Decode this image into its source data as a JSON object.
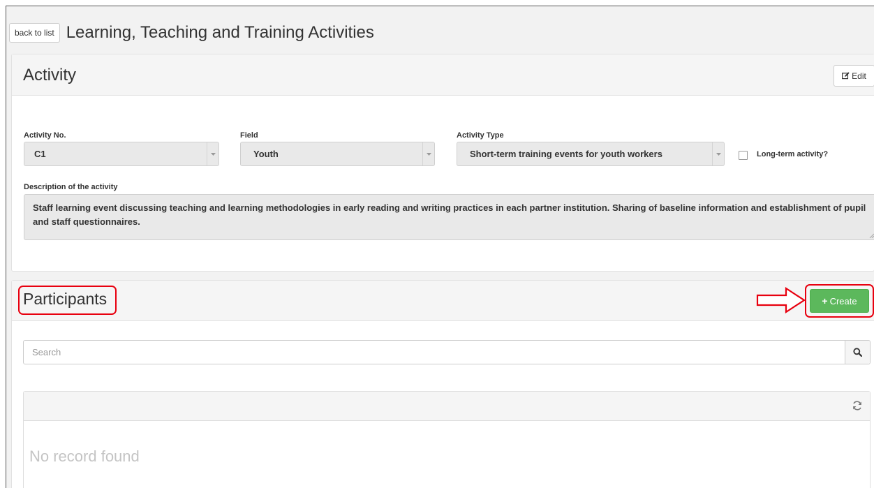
{
  "header": {
    "back_label": "back to list",
    "title": "Learning, Teaching and Training Activities"
  },
  "activity": {
    "title": "Activity",
    "edit_label": "Edit",
    "edit_icon": "edit-icon",
    "fields": {
      "activity_no": {
        "label": "Activity No.",
        "value": "C1"
      },
      "field": {
        "label": "Field",
        "value": "Youth"
      },
      "activity_type": {
        "label": "Activity Type",
        "value": "Short-term training events for youth workers"
      },
      "long_term": {
        "label": "Long-term activity?",
        "checked": false
      }
    },
    "description": {
      "label": "Description of the activity",
      "value": "Staff learning event discussing teaching and learning methodologies in early reading and writing practices in each partner institution. Sharing of baseline information and establishment of pupil and staff questionnaires."
    }
  },
  "participants": {
    "title": "Participants",
    "create_label": "Create",
    "search": {
      "placeholder": "Search",
      "value": ""
    },
    "empty_message": "No record found"
  },
  "colors": {
    "create_button": "#5cb85c",
    "annotation_red": "#e8000f"
  }
}
